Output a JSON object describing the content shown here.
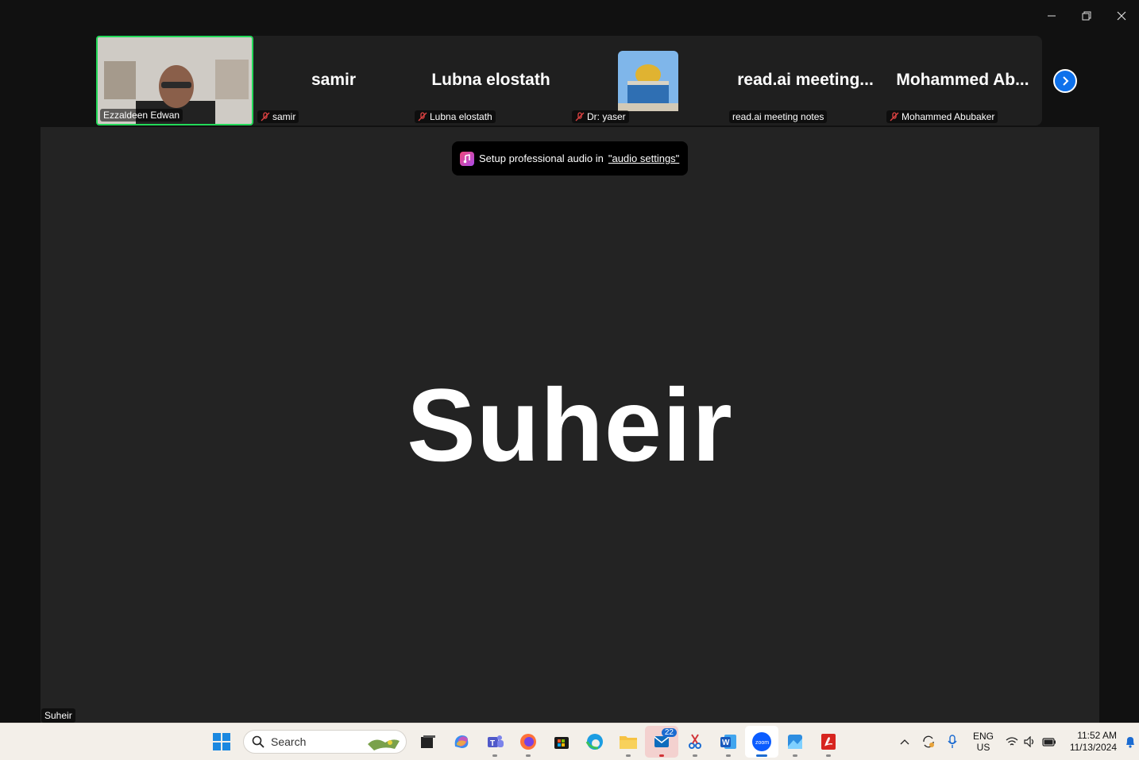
{
  "participants": [
    {
      "name": "Ezzaldeen Edwan",
      "label": "Ezzaldeen Edwan",
      "muted": false,
      "video": true,
      "active_speaker": true
    },
    {
      "name": "samir",
      "label": "samir",
      "muted": true
    },
    {
      "name": "Lubna elostath",
      "label": "Lubna elostath",
      "muted": true
    },
    {
      "name": "",
      "label": "Dr: yaser",
      "muted": true,
      "avatar": "dome-of-the-rock-photo"
    },
    {
      "name": "read.ai  meeting...",
      "label": "read.ai meeting notes",
      "muted": false
    },
    {
      "name": "Mohammed  Ab...",
      "label": "Mohammed Abubaker",
      "muted": true
    }
  ],
  "stage": {
    "name": "Suheir",
    "label": "Suheir"
  },
  "notice": {
    "text": "Setup professional audio in",
    "link": "\"audio settings\""
  },
  "taskbar": {
    "search_placeholder": "Search",
    "outlook_badge": "22",
    "lang_1": "ENG",
    "lang_2": "US",
    "time": "11:52 AM",
    "date": "11/13/2024"
  },
  "colors": {
    "active_border": "#23d959",
    "accent": "#0e71eb",
    "stage_bg": "#232323"
  }
}
